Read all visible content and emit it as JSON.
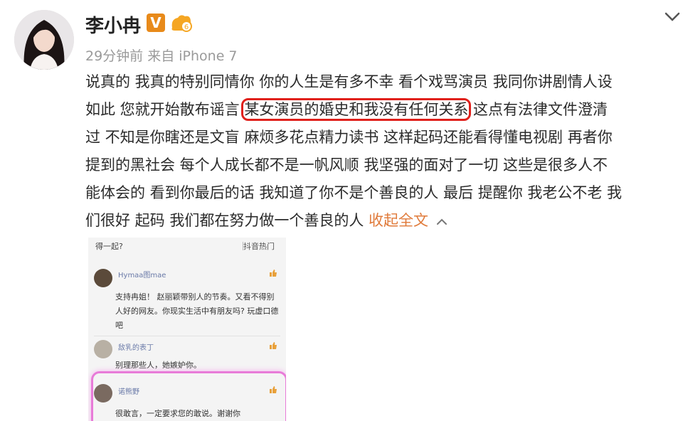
{
  "post": {
    "username": "李小冉",
    "verified_badge": "V",
    "level_badge_icon": "weibo-level-badge-icon",
    "meta": "29分钟前 来自 iPhone 7",
    "lines": [
      "说真的 我真的特别同情你 你的人生是有多不幸 看个戏骂演员 我同你讲剧情人设",
      "过 不知是你瞎还是文盲 麻烦多花点精力读书 这样起码还能看得懂电视剧 再者你",
      "提到的黑社会 每个人成长都不是一帆风顺 我坚强的面对了一切 这些是很多人不",
      "能体会的 看到你最后的话 我知道了你不是个善良的人 最后 提醒你 我老公不老 我"
    ],
    "line2_before": "如此 您就开始散布谣言 ",
    "line2_highlight": "某女演员的婚史和我没有任何关系",
    "line2_after": " 这点有法律文件澄清",
    "line6_text": "们很好 起码 我们都在努力做一个善良的人 ",
    "collapse_label": "收起全文",
    "accent": "#e07a3a",
    "highlight_color": "#e0201b"
  },
  "screenshot": {
    "top_left": "得一起?",
    "top_right": "抖音热门",
    "comments": [
      {
        "name": "Hymaa图mae",
        "text": "支持冉姐！ 赵丽颖带别人的节奏。又看不得别人好的网友。你现实生活中有朋友吗? 玩虚口德吧"
      },
      {
        "name": "敌乳的表丁",
        "text": "别理那些人，她嫉妒你。"
      },
      {
        "name": "诺熊野",
        "text": "很敢言，一定要求您的敢说。谢谢你"
      }
    ],
    "highlight_color": "#e87bd8"
  }
}
